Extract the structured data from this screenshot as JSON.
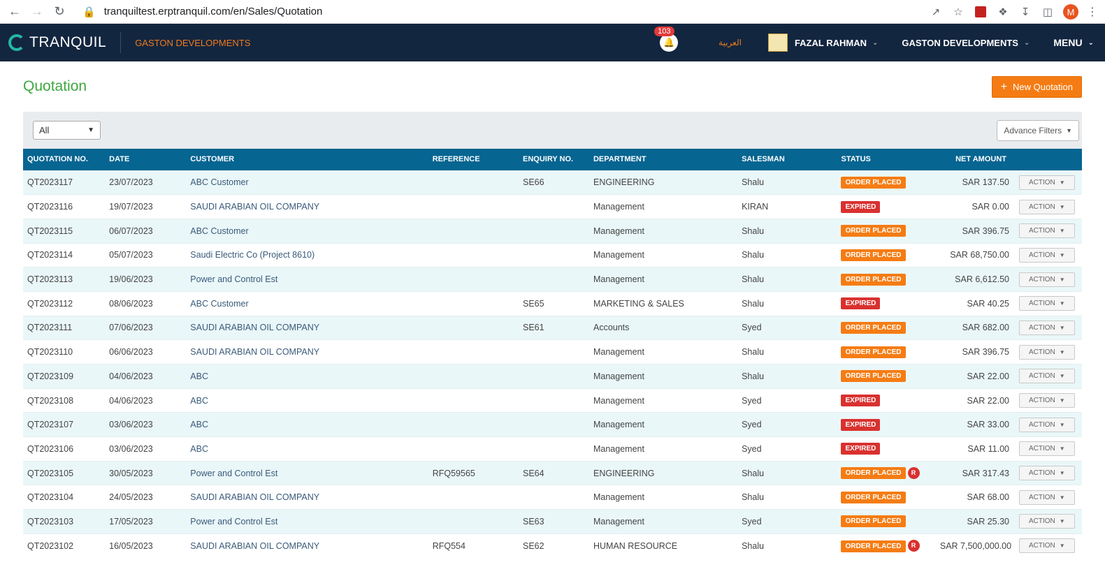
{
  "browser": {
    "url": "tranquiltest.erptranquil.com/en/Sales/Quotation",
    "profile_initial": "M"
  },
  "header": {
    "logo_text": "TRANQUIL",
    "company": "GASTON DEVELOPMENTS",
    "notification_count": "103",
    "language_link": "العربية",
    "user_name": "FAZAL RAHMAN",
    "company_switch": "GASTON DEVELOPMENTS",
    "menu_label": "MENU"
  },
  "page": {
    "title": "Quotation",
    "new_button": "New Quotation",
    "filter_value": "All",
    "advance_filters": "Advance Filters"
  },
  "table": {
    "columns": [
      "QUOTATION NO.",
      "DATE",
      "CUSTOMER",
      "REFERENCE",
      "ENQUIRY NO.",
      "DEPARTMENT",
      "SALESMAN",
      "STATUS",
      "NET AMOUNT"
    ],
    "action_label": "ACTION",
    "rows": [
      {
        "no": "QT2023117",
        "date": "23/07/2023",
        "customer": "ABC Customer",
        "ref": "",
        "enq": "SE66",
        "dept": "ENGINEERING",
        "salesman": "Shalu",
        "status": "ORDER PLACED",
        "rev": "",
        "amount": "SAR 137.50"
      },
      {
        "no": "QT2023116",
        "date": "19/07/2023",
        "customer": "SAUDI ARABIAN OIL COMPANY",
        "ref": "",
        "enq": "",
        "dept": "Management",
        "salesman": "KIRAN",
        "status": "EXPIRED",
        "rev": "",
        "amount": "SAR 0.00"
      },
      {
        "no": "QT2023115",
        "date": "06/07/2023",
        "customer": "ABC Customer",
        "ref": "",
        "enq": "",
        "dept": "Management",
        "salesman": "Shalu",
        "status": "ORDER PLACED",
        "rev": "",
        "amount": "SAR 396.75"
      },
      {
        "no": "QT2023114",
        "date": "05/07/2023",
        "customer": "Saudi Electric Co (Project 8610)",
        "ref": "",
        "enq": "",
        "dept": "Management",
        "salesman": "Shalu",
        "status": "ORDER PLACED",
        "rev": "",
        "amount": "SAR 68,750.00"
      },
      {
        "no": "QT2023113",
        "date": "19/06/2023",
        "customer": "Power and Control Est",
        "ref": "",
        "enq": "",
        "dept": "Management",
        "salesman": "Shalu",
        "status": "ORDER PLACED",
        "rev": "",
        "amount": "SAR 6,612.50"
      },
      {
        "no": "QT2023112",
        "date": "08/06/2023",
        "customer": "ABC Customer",
        "ref": "",
        "enq": "SE65",
        "dept": "MARKETING & SALES",
        "salesman": "Shalu",
        "status": "EXPIRED",
        "rev": "",
        "amount": "SAR 40.25"
      },
      {
        "no": "QT2023111",
        "date": "07/06/2023",
        "customer": "SAUDI ARABIAN OIL COMPANY",
        "ref": "",
        "enq": "SE61",
        "dept": "Accounts",
        "salesman": "Syed",
        "status": "ORDER PLACED",
        "rev": "",
        "amount": "SAR 682.00"
      },
      {
        "no": "QT2023110",
        "date": "06/06/2023",
        "customer": "SAUDI ARABIAN OIL COMPANY",
        "ref": "",
        "enq": "",
        "dept": "Management",
        "salesman": "Shalu",
        "status": "ORDER PLACED",
        "rev": "",
        "amount": "SAR 396.75"
      },
      {
        "no": "QT2023109",
        "date": "04/06/2023",
        "customer": "ABC",
        "ref": "",
        "enq": "",
        "dept": "Management",
        "salesman": "Shalu",
        "status": "ORDER PLACED",
        "rev": "",
        "amount": "SAR 22.00"
      },
      {
        "no": "QT2023108",
        "date": "04/06/2023",
        "customer": "ABC",
        "ref": "",
        "enq": "",
        "dept": "Management",
        "salesman": "Syed",
        "status": "EXPIRED",
        "rev": "",
        "amount": "SAR 22.00"
      },
      {
        "no": "QT2023107",
        "date": "03/06/2023",
        "customer": "ABC",
        "ref": "",
        "enq": "",
        "dept": "Management",
        "salesman": "Syed",
        "status": "EXPIRED",
        "rev": "",
        "amount": "SAR 33.00"
      },
      {
        "no": "QT2023106",
        "date": "03/06/2023",
        "customer": "ABC",
        "ref": "",
        "enq": "",
        "dept": "Management",
        "salesman": "Syed",
        "status": "EXPIRED",
        "rev": "",
        "amount": "SAR 11.00"
      },
      {
        "no": "QT2023105",
        "date": "30/05/2023",
        "customer": "Power and Control Est",
        "ref": "RFQ59565",
        "enq": "SE64",
        "dept": "ENGINEERING",
        "salesman": "Shalu",
        "status": "ORDER PLACED",
        "rev": "R",
        "amount": "SAR 317.43"
      },
      {
        "no": "QT2023104",
        "date": "24/05/2023",
        "customer": "SAUDI ARABIAN OIL COMPANY",
        "ref": "",
        "enq": "",
        "dept": "Management",
        "salesman": "Shalu",
        "status": "ORDER PLACED",
        "rev": "",
        "amount": "SAR 68.00"
      },
      {
        "no": "QT2023103",
        "date": "17/05/2023",
        "customer": "Power and Control Est",
        "ref": "",
        "enq": "SE63",
        "dept": "Management",
        "salesman": "Syed",
        "status": "ORDER PLACED",
        "rev": "",
        "amount": "SAR 25.30"
      },
      {
        "no": "QT2023102",
        "date": "16/05/2023",
        "customer": "SAUDI ARABIAN OIL COMPANY",
        "ref": "RFQ554",
        "enq": "SE62",
        "dept": "HUMAN RESOURCE",
        "salesman": "Shalu",
        "status": "ORDER PLACED",
        "rev": "R",
        "amount": "SAR 7,500,000.00"
      }
    ]
  }
}
